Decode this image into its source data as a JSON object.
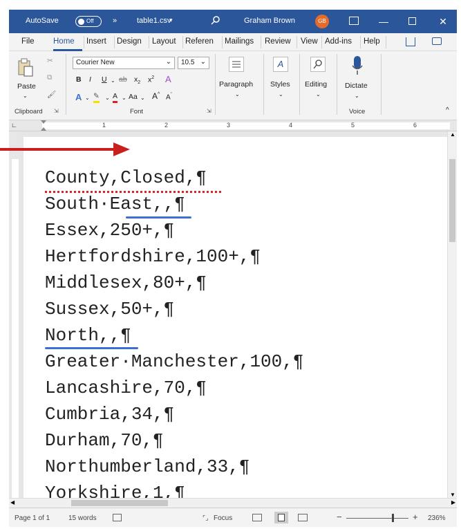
{
  "titlebar": {
    "autosave_label": "AutoSave",
    "autosave_state": "Off",
    "more_glyph": "»",
    "filename": "table1.csv",
    "dropdown_glyph": "▾",
    "user_name": "Graham Brown",
    "user_initials": "GB",
    "accent": "#2b579a"
  },
  "tabs": [
    "File",
    "Home",
    "Insert",
    "Design",
    "Layout",
    "Referen",
    "Mailings",
    "Review",
    "View",
    "Add-ins",
    "Help"
  ],
  "ribbon": {
    "paste_label": "Paste",
    "clipboard_group": "Clipboard",
    "font_name": "Courier New",
    "font_size": "10.5",
    "bold": "B",
    "italic": "I",
    "underline": "U",
    "strike": "ab",
    "subscript": "x",
    "superscript": "x",
    "text_effects": "A",
    "highlight": "✎",
    "font_color": "A",
    "change_case": "Aa",
    "grow_font": "A",
    "shrink_font": "A",
    "font_group": "Font",
    "paragraph_label": "Paragraph",
    "styles_label": "Styles",
    "editing_label": "Editing",
    "dictate_label": "Dictate",
    "voice_group": "Voice"
  },
  "ruler_numbers": [
    "1",
    "2",
    "3",
    "4",
    "5",
    "6"
  ],
  "document": {
    "lines": [
      "County,Closed,¶",
      "South·East,,¶",
      "Essex,250+,¶",
      "Hertfordshire,100+,¶",
      "Middlesex,80+,¶",
      "Sussex,50+,¶",
      "North,,¶",
      "Greater·Manchester,100,¶",
      "Lancashire,70,¶",
      "Cumbria,34,¶",
      "Durham,70,¶",
      "Northumberland,33,¶",
      "Yorkshire,1,¶"
    ]
  },
  "statusbar": {
    "page": "Page 1 of 1",
    "words": "15 words",
    "focus": "Focus",
    "zoom_minus": "−",
    "zoom_plus": "+",
    "zoom": "236%"
  }
}
